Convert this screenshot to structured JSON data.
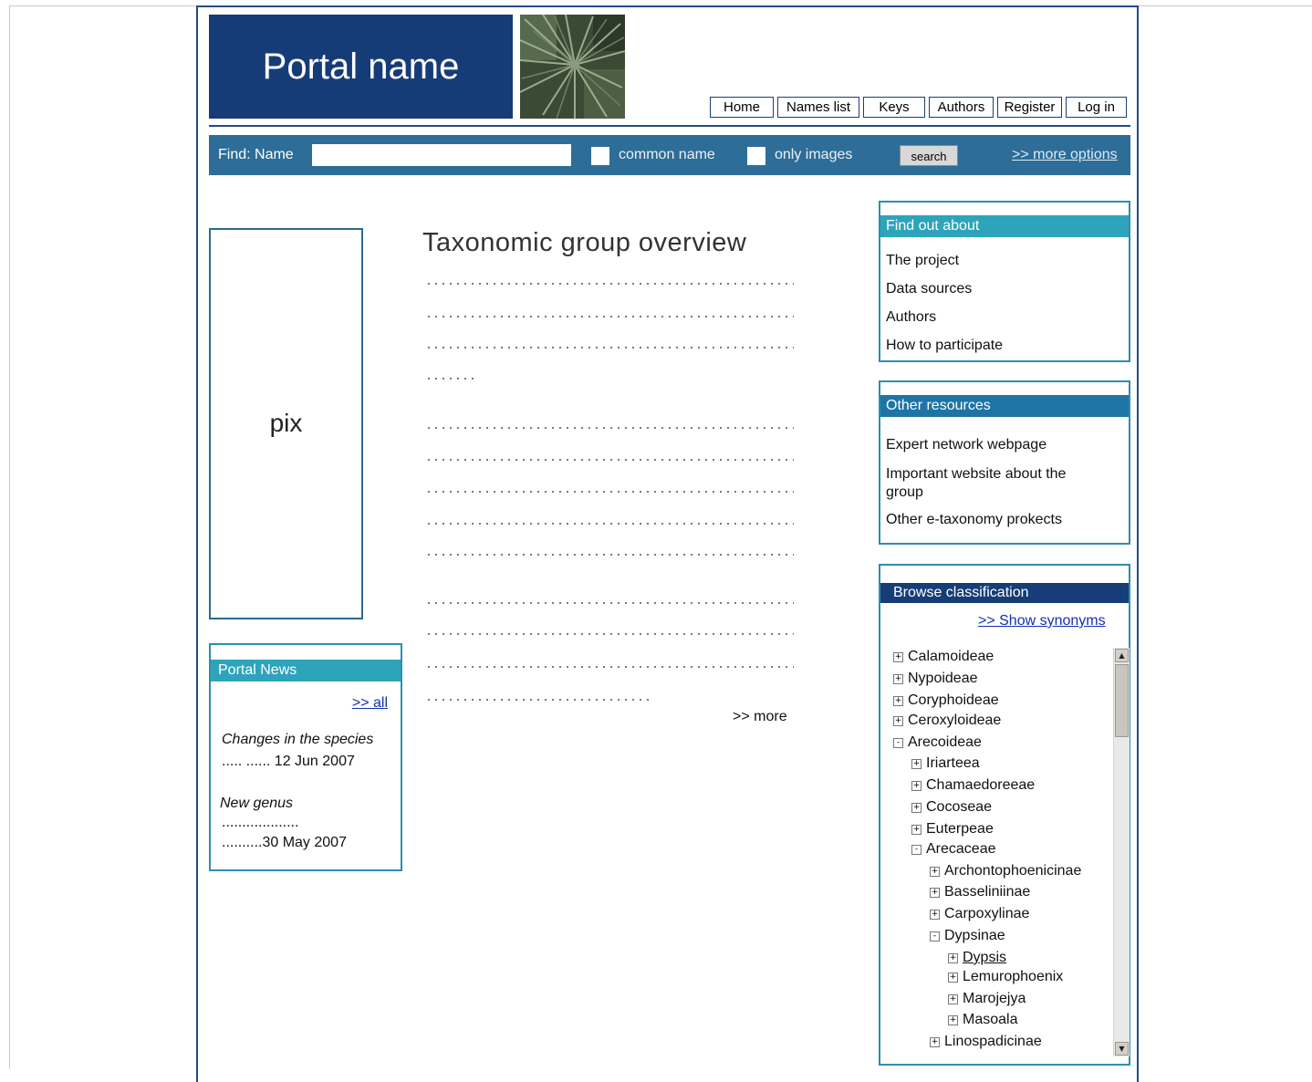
{
  "header": {
    "portal_name": "Portal name",
    "nav": [
      "Home",
      "Names list",
      "Keys",
      "Authors",
      "Register",
      "Log in"
    ]
  },
  "find": {
    "label": "Find:  Name",
    "input_value": "",
    "common_name_label": "common name",
    "only_images_label": "only images",
    "search_label": "search",
    "more_options": ">> more options"
  },
  "left": {
    "pix_label": "pix",
    "news": {
      "title": "Portal  News",
      "all_link": ">> all",
      "item1_title": "Changes in the species",
      "item1_meta": "..... ...... 12 Jun 2007",
      "item2_title": "New genus",
      "item2_dots": "...................",
      "item2_meta": "..........30 May 2007"
    }
  },
  "main": {
    "title": "Taxonomic group  overview",
    "more": ">> more"
  },
  "right": {
    "find_out": {
      "title": "Find out about",
      "items": [
        "The project",
        "Data sources",
        "Authors",
        "How to participate"
      ]
    },
    "other_resources": {
      "title": "Other resources",
      "items": [
        "Expert network webpage",
        "Important website about the group",
        "Other e-taxonomy prokects"
      ]
    },
    "browse": {
      "title": "Browse classification",
      "show_synonyms": ">> Show synonyms",
      "tree": [
        {
          "label": "Calamoideae",
          "toggle": "+"
        },
        {
          "label": "Nypoideae",
          "toggle": "+"
        },
        {
          "label": "Coryphoideae",
          "toggle": "+"
        },
        {
          "label": "Ceroxyloideae",
          "toggle": "+"
        },
        {
          "label": "Arecoideae",
          "toggle": "-"
        },
        {
          "label": "Iriarteea",
          "toggle": "+"
        },
        {
          "label": "Chamaedoreeae",
          "toggle": "+"
        },
        {
          "label": "Cocoseae",
          "toggle": "+"
        },
        {
          "label": "Euterpeae",
          "toggle": "+"
        },
        {
          "label": "Arecaceae",
          "toggle": "-"
        },
        {
          "label": "Archontophoenicinae",
          "toggle": "+"
        },
        {
          "label": "Basseliniinae",
          "toggle": "+"
        },
        {
          "label": "Carpoxylinae",
          "toggle": "+"
        },
        {
          "label": "Dypsinae",
          "toggle": "-"
        },
        {
          "label": "Dypsis",
          "toggle": "+"
        },
        {
          "label": "Lemurophoenix",
          "toggle": "+"
        },
        {
          "label": "Marojejya",
          "toggle": "+"
        },
        {
          "label": "Masoala",
          "toggle": "+"
        },
        {
          "label": "Linospadicinae",
          "toggle": "+"
        }
      ]
    }
  },
  "colors": {
    "logo_bg": "#163c78",
    "find_bar": "#2d6d98",
    "teal_header": "#2ea4bb",
    "resources_header": "#1e74a4",
    "browse_header": "#173d78",
    "link": "#1330b0"
  }
}
